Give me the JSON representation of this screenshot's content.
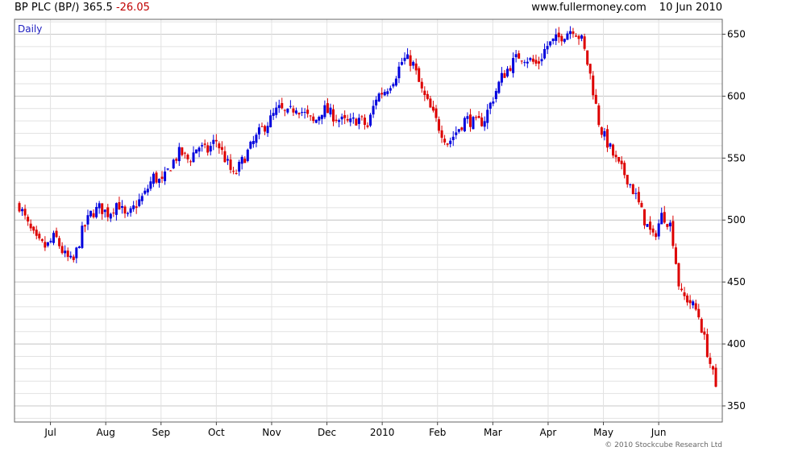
{
  "header": {
    "instrument": "BP PLC (BP/) 365.5",
    "change": "-26.05",
    "site": "www.fullermoney.com",
    "date": "10 Jun 2010"
  },
  "copyright": "© 2010 Stockcube Research Ltd",
  "colors": {
    "up": "#0000dd",
    "down": "#dd0000",
    "grid": "#e2e2e2",
    "frame": "#666666"
  },
  "chart_data": {
    "type": "candlestick",
    "period_label": "Daily",
    "y_ticks": [
      350,
      400,
      450,
      500,
      550,
      600,
      650
    ],
    "ylim": [
      337,
      662
    ],
    "y_axis_side": "right",
    "x_ticks": [
      "Jul",
      "Aug",
      "Sep",
      "Oct",
      "Nov",
      "Dec",
      "2010",
      "Feb",
      "Mar",
      "Apr",
      "May",
      "Jun"
    ],
    "grid": true,
    "close_path": [
      [
        "Jun",
        512
      ],
      [
        "Jun",
        495
      ],
      [
        "Jun",
        482
      ],
      [
        "Jul",
        478
      ],
      [
        "Jul",
        487
      ],
      [
        "Jul",
        472
      ],
      [
        "Jul",
        465
      ],
      [
        "Jul",
        490
      ],
      [
        "Jul",
        505
      ],
      [
        "Aug",
        510
      ],
      [
        "Aug",
        505
      ],
      [
        "Aug",
        515
      ],
      [
        "Aug",
        500
      ],
      [
        "Aug",
        512
      ],
      [
        "Aug",
        520
      ],
      [
        "Aug",
        535
      ],
      [
        "Aug",
        530
      ],
      [
        "Sep",
        545
      ],
      [
        "Sep",
        555
      ],
      [
        "Sep",
        548
      ],
      [
        "Sep",
        560
      ],
      [
        "Sep",
        555
      ],
      [
        "Sep",
        565
      ],
      [
        "Oct",
        550
      ],
      [
        "Oct",
        535
      ],
      [
        "Oct",
        548
      ],
      [
        "Oct",
        560
      ],
      [
        "Oct",
        572
      ],
      [
        "Oct",
        580
      ],
      [
        "Nov",
        590
      ],
      [
        "Nov",
        585
      ],
      [
        "Nov",
        592
      ],
      [
        "Nov",
        585
      ],
      [
        "Nov",
        578
      ],
      [
        "Nov",
        590
      ],
      [
        "Dec",
        585
      ],
      [
        "Dec",
        580
      ],
      [
        "Dec",
        578
      ],
      [
        "Dec",
        582
      ],
      [
        "Dec",
        575
      ],
      [
        "Dec",
        600
      ],
      [
        "Dec",
        605
      ],
      [
        "2010",
        615
      ],
      [
        "2010",
        630
      ],
      [
        "2010",
        628
      ],
      [
        "2010",
        605
      ],
      [
        "2010",
        590
      ],
      [
        "Feb",
        575
      ],
      [
        "Feb",
        562
      ],
      [
        "Feb",
        572
      ],
      [
        "Feb",
        582
      ],
      [
        "Feb",
        578
      ],
      [
        "Mar",
        580
      ],
      [
        "Mar",
        598
      ],
      [
        "Mar",
        615
      ],
      [
        "Mar",
        625
      ],
      [
        "Mar",
        633
      ],
      [
        "Mar",
        630
      ],
      [
        "Mar",
        625
      ],
      [
        "Apr",
        640
      ],
      [
        "Apr",
        645
      ],
      [
        "Apr",
        650
      ],
      [
        "Apr",
        655
      ],
      [
        "Apr",
        645
      ],
      [
        "Apr",
        615
      ],
      [
        "May",
        575
      ],
      [
        "May",
        560
      ],
      [
        "May",
        545
      ],
      [
        "May",
        535
      ],
      [
        "May",
        520
      ],
      [
        "May",
        500
      ],
      [
        "May",
        485
      ],
      [
        "Jun",
        505
      ],
      [
        "Jun",
        495
      ],
      [
        "Jun",
        440
      ],
      [
        "Jun",
        435
      ],
      [
        "Jun",
        425
      ],
      [
        "Jun",
        395
      ],
      [
        "Jun",
        365.5
      ]
    ]
  }
}
